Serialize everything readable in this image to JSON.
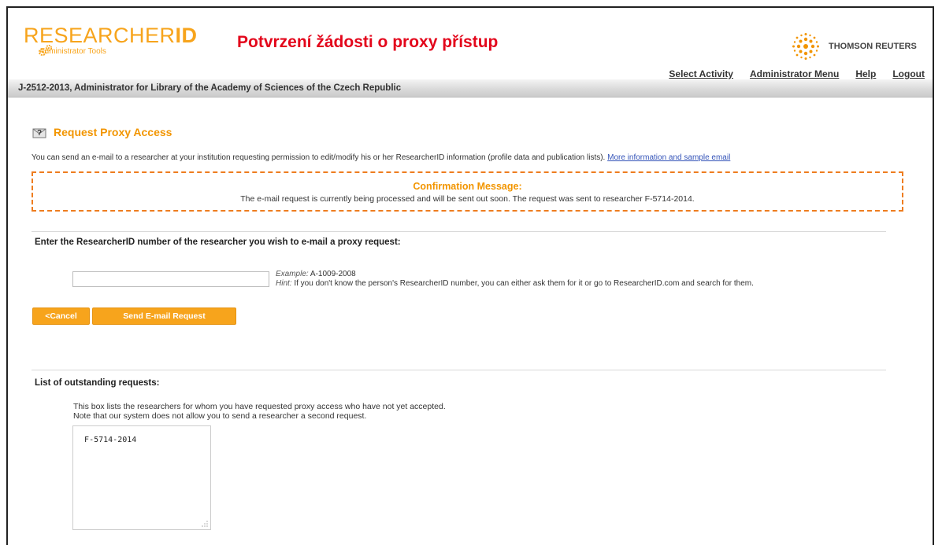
{
  "header": {
    "logo_researcher": "RESEARCHER",
    "logo_id": "ID",
    "logo_sub": "Administrator Tools",
    "page_heading": "Potvrzení žádosti o proxy přístup",
    "brand": "THOMSON REUTERS"
  },
  "nav": [
    "Select Activity",
    "Administrator Menu",
    "Help",
    "Logout"
  ],
  "account_bar": "J-2512-2013, Administrator for Library of the Academy of Sciences of the Czech Republic",
  "section": {
    "title": "Request Proxy Access",
    "intro": "You can send an e-mail to a researcher at your institution requesting permission to edit/modify his or her ResearcherID information (profile data and publication lists).",
    "more_link": "More information and sample email"
  },
  "confirmation": {
    "title": "Confirmation Message:",
    "message": "The e-mail request is currently being processed and will be sent out soon. The request was sent to researcher F-5714-2014."
  },
  "form": {
    "prompt": "Enter the ResearcherID number of the researcher you wish to e-mail a proxy request:",
    "input_value": "",
    "example_label": "Example:",
    "example_value": "A-1009-2008",
    "hint_label": "Hint:",
    "hint_text": "If you don't know the person's ResearcherID number, you can either ask them for it or go to ResearcherID.com and search for them.",
    "cancel_label": "<Cancel",
    "send_label": "Send E-mail Request"
  },
  "outstanding": {
    "title": "List of outstanding requests:",
    "desc_line1": "This box lists the researchers for whom you have requested proxy access who have not yet accepted.",
    "desc_line2": "Note that our system does not allow you to send a researcher a second request.",
    "items": "F-5714-2014"
  },
  "colors": {
    "accent": "#f7a41c",
    "heading_red": "#e3061b",
    "link": "#3353b8",
    "dash": "#ee7d1f"
  }
}
